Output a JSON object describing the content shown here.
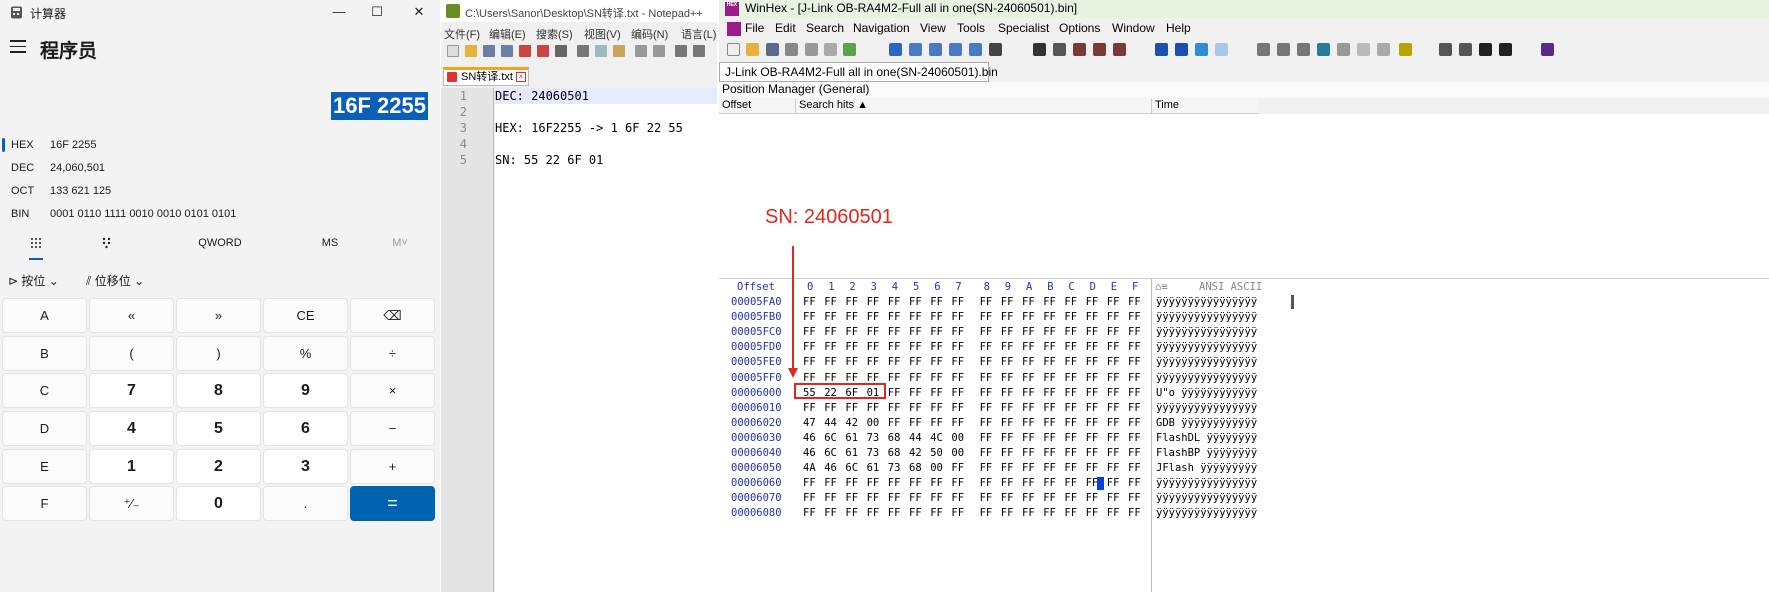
{
  "calculator": {
    "title": "计算器",
    "mode": "程序员",
    "display": "16F 2255",
    "radix": [
      {
        "label": "HEX",
        "value": "16F 2255"
      },
      {
        "label": "DEC",
        "value": "24,060,501"
      },
      {
        "label": "OCT",
        "value": "133 621 125"
      },
      {
        "label": "BIN",
        "value": "0001 0110 1111 0010 0010 0101 0101"
      }
    ],
    "tabs": {
      "qword": "QWORD",
      "ms": "MS",
      "mplus": "M˅"
    },
    "bitwise": "按位",
    "bitshift": "位移位",
    "keys": [
      [
        "A",
        "«",
        "»",
        "CE",
        "⌫"
      ],
      [
        "B",
        "(",
        ")",
        "%",
        "÷"
      ],
      [
        "C",
        "7",
        "8",
        "9",
        "×"
      ],
      [
        "D",
        "4",
        "5",
        "6",
        "−"
      ],
      [
        "E",
        "1",
        "2",
        "3",
        "+"
      ],
      [
        "F",
        "⁺∕₋",
        "0",
        ".",
        "="
      ]
    ]
  },
  "notepad": {
    "title": "C:\\Users\\Sanor\\Desktop\\SN转译.txt - Notepad++",
    "menu": [
      "文件(F)",
      "编辑(E)",
      "搜索(S)",
      "视图(V)",
      "编码(N)",
      "语言(L)"
    ],
    "tab": "SN转译.txt",
    "line_numbers": [
      "1",
      "2",
      "3",
      "4",
      "5"
    ],
    "lines": [
      "DEC: 24060501",
      "",
      "HEX: 16F2255 -> 1 6F 22 55",
      "",
      "SN: 55 22 6F 01"
    ]
  },
  "winhex": {
    "logo": "HEX",
    "title": "WinHex - [J-Link OB-RA4M2-Full all in one(SN-24060501).bin]",
    "menu": [
      "File",
      "Edit",
      "Search",
      "Navigation",
      "View",
      "Tools",
      "Specialist",
      "Options",
      "Window",
      "Help"
    ],
    "doc_tab": "J-Link OB-RA4M2-Full all in one(SN-24060501).bin",
    "position_manager": "Position Manager (General)",
    "columns": [
      "Offset",
      "Search hits ▲",
      "Time"
    ],
    "annotation": "SN: 24060501",
    "hex_header": {
      "offset": "Offset",
      "cols": [
        "0",
        "1",
        "2",
        "3",
        "4",
        "5",
        "6",
        "7",
        "8",
        "9",
        "A",
        "B",
        "C",
        "D",
        "E",
        "F"
      ],
      "ansi": "ANSI ASCII"
    },
    "rows": [
      {
        "off": "00005FA0",
        "bytes": [
          "FF",
          "FF",
          "FF",
          "FF",
          "FF",
          "FF",
          "FF",
          "FF",
          "FF",
          "FF",
          "FF",
          "FF",
          "FF",
          "FF",
          "FF",
          "FF"
        ],
        "ascii": "ÿÿÿÿÿÿÿÿÿÿÿÿÿÿÿÿ"
      },
      {
        "off": "00005FB0",
        "bytes": [
          "FF",
          "FF",
          "FF",
          "FF",
          "FF",
          "FF",
          "FF",
          "FF",
          "FF",
          "FF",
          "FF",
          "FF",
          "FF",
          "FF",
          "FF",
          "FF"
        ],
        "ascii": "ÿÿÿÿÿÿÿÿÿÿÿÿÿÿÿÿ"
      },
      {
        "off": "00005FC0",
        "bytes": [
          "FF",
          "FF",
          "FF",
          "FF",
          "FF",
          "FF",
          "FF",
          "FF",
          "FF",
          "FF",
          "FF",
          "FF",
          "FF",
          "FF",
          "FF",
          "FF"
        ],
        "ascii": "ÿÿÿÿÿÿÿÿÿÿÿÿÿÿÿÿ"
      },
      {
        "off": "00005FD0",
        "bytes": [
          "FF",
          "FF",
          "FF",
          "FF",
          "FF",
          "FF",
          "FF",
          "FF",
          "FF",
          "FF",
          "FF",
          "FF",
          "FF",
          "FF",
          "FF",
          "FF"
        ],
        "ascii": "ÿÿÿÿÿÿÿÿÿÿÿÿÿÿÿÿ"
      },
      {
        "off": "00005FE0",
        "bytes": [
          "FF",
          "FF",
          "FF",
          "FF",
          "FF",
          "FF",
          "FF",
          "FF",
          "FF",
          "FF",
          "FF",
          "FF",
          "FF",
          "FF",
          "FF",
          "FF"
        ],
        "ascii": "ÿÿÿÿÿÿÿÿÿÿÿÿÿÿÿÿ"
      },
      {
        "off": "00005FF0",
        "bytes": [
          "FF",
          "FF",
          "FF",
          "FF",
          "FF",
          "FF",
          "FF",
          "FF",
          "FF",
          "FF",
          "FF",
          "FF",
          "FF",
          "FF",
          "FF",
          "FF"
        ],
        "ascii": "ÿÿÿÿÿÿÿÿÿÿÿÿÿÿÿÿ"
      },
      {
        "off": "00006000",
        "bytes": [
          "55",
          "22",
          "6F",
          "01",
          "FF",
          "FF",
          "FF",
          "FF",
          "FF",
          "FF",
          "FF",
          "FF",
          "FF",
          "FF",
          "FF",
          "FF"
        ],
        "ascii": "U\"o ÿÿÿÿÿÿÿÿÿÿÿÿ"
      },
      {
        "off": "00006010",
        "bytes": [
          "FF",
          "FF",
          "FF",
          "FF",
          "FF",
          "FF",
          "FF",
          "FF",
          "FF",
          "FF",
          "FF",
          "FF",
          "FF",
          "FF",
          "FF",
          "FF"
        ],
        "ascii": "ÿÿÿÿÿÿÿÿÿÿÿÿÿÿÿÿ"
      },
      {
        "off": "00006020",
        "bytes": [
          "47",
          "44",
          "42",
          "00",
          "FF",
          "FF",
          "FF",
          "FF",
          "FF",
          "FF",
          "FF",
          "FF",
          "FF",
          "FF",
          "FF",
          "FF"
        ],
        "ascii": "GDB ÿÿÿÿÿÿÿÿÿÿÿÿ"
      },
      {
        "off": "00006030",
        "bytes": [
          "46",
          "6C",
          "61",
          "73",
          "68",
          "44",
          "4C",
          "00",
          "FF",
          "FF",
          "FF",
          "FF",
          "FF",
          "FF",
          "FF",
          "FF"
        ],
        "ascii": "FlashDL ÿÿÿÿÿÿÿÿ"
      },
      {
        "off": "00006040",
        "bytes": [
          "46",
          "6C",
          "61",
          "73",
          "68",
          "42",
          "50",
          "00",
          "FF",
          "FF",
          "FF",
          "FF",
          "FF",
          "FF",
          "FF",
          "FF"
        ],
        "ascii": "FlashBP ÿÿÿÿÿÿÿÿ"
      },
      {
        "off": "00006050",
        "bytes": [
          "4A",
          "46",
          "6C",
          "61",
          "73",
          "68",
          "00",
          "FF",
          "FF",
          "FF",
          "FF",
          "FF",
          "FF",
          "FF",
          "FF",
          "FF"
        ],
        "ascii": "JFlash ÿÿÿÿÿÿÿÿÿ"
      },
      {
        "off": "00006060",
        "bytes": [
          "FF",
          "FF",
          "FF",
          "FF",
          "FF",
          "FF",
          "FF",
          "FF",
          "FF",
          "FF",
          "FF",
          "FF",
          "FF",
          "FF",
          "FF",
          "FF"
        ],
        "ascii": "ÿÿÿÿÿÿÿÿÿÿÿÿÿÿÿÿ"
      },
      {
        "off": "00006070",
        "bytes": [
          "FF",
          "FF",
          "FF",
          "FF",
          "FF",
          "FF",
          "FF",
          "FF",
          "FF",
          "FF",
          "FF",
          "FF",
          "FF",
          "FF",
          "FF",
          "FF"
        ],
        "ascii": "ÿÿÿÿÿÿÿÿÿÿÿÿÿÿÿÿ"
      },
      {
        "off": "00006080",
        "bytes": [
          "FF",
          "FF",
          "FF",
          "FF",
          "FF",
          "FF",
          "FF",
          "FF",
          "FF",
          "FF",
          "FF",
          "FF",
          "FF",
          "FF",
          "FF",
          "FF"
        ],
        "ascii": "ÿÿÿÿÿÿÿÿÿÿÿÿÿÿÿÿ"
      }
    ]
  }
}
